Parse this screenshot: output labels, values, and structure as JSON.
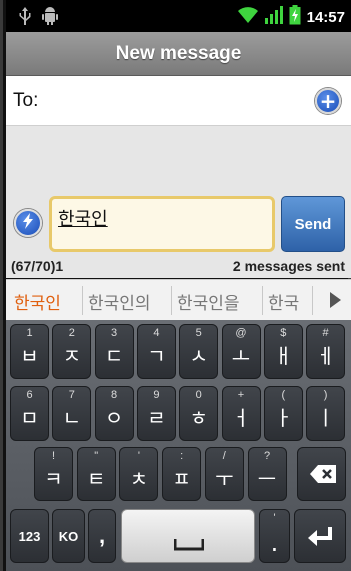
{
  "status_bar": {
    "left_icons": [
      "usb-icon",
      "android-debug-icon"
    ],
    "right_icons": [
      "wifi-icon",
      "signal-icon",
      "battery-charging-icon"
    ],
    "time": "14:57"
  },
  "header": {
    "title": "New message"
  },
  "recipient": {
    "label": "To:",
    "add_icon": "plus-icon"
  },
  "compose": {
    "message_text": "한국인",
    "send_label": "Send",
    "smiley_icon": "lightning-icon"
  },
  "counter": {
    "chars": "(67/70)1",
    "messages": "2 messages sent"
  },
  "suggestions": {
    "items": [
      "한국인",
      "한국인의",
      "한국인을",
      "한국"
    ],
    "more_icon": "right-arrow-icon"
  },
  "keyboard": {
    "row1": [
      {
        "sub": "1",
        "main": "ㅂ"
      },
      {
        "sub": "2",
        "main": "ㅈ"
      },
      {
        "sub": "3",
        "main": "ㄷ"
      },
      {
        "sub": "4",
        "main": "ㄱ"
      },
      {
        "sub": "5",
        "main": "ㅅ"
      },
      {
        "sub": "@",
        "main": "ㅗ"
      },
      {
        "sub": "$",
        "main": "ㅐ"
      },
      {
        "sub": "#",
        "main": "ㅔ"
      }
    ],
    "row2": [
      {
        "sub": "6",
        "main": "ㅁ"
      },
      {
        "sub": "7",
        "main": "ㄴ"
      },
      {
        "sub": "8",
        "main": "ㅇ"
      },
      {
        "sub": "9",
        "main": "ㄹ"
      },
      {
        "sub": "0",
        "main": "ㅎ"
      },
      {
        "sub": "+",
        "main": "ㅓ"
      },
      {
        "sub": "(",
        "main": "ㅏ"
      },
      {
        "sub": ")",
        "main": "ㅣ"
      }
    ],
    "row3": [
      {
        "sub": "!",
        "main": "ㅋ"
      },
      {
        "sub": "\"",
        "main": "ㅌ"
      },
      {
        "sub": "'",
        "main": "ㅊ"
      },
      {
        "sub": ":",
        "main": "ㅍ"
      },
      {
        "sub": "/",
        "main": "ㅜ"
      },
      {
        "sub": "?",
        "main": "ㅡ"
      }
    ],
    "delete_icon": "backspace-icon",
    "bottom": {
      "num_label": "123",
      "lang_label": "KO",
      "comma_label": ",",
      "space_icon": "space-icon",
      "period_sub": "'",
      "period_label": ".",
      "enter_icon": "enter-icon"
    }
  }
}
